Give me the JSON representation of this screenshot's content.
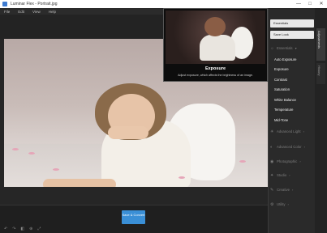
{
  "window": {
    "title": "Luminar Flex - Portrait.jpg",
    "controls": [
      "—",
      "□",
      "✕"
    ]
  },
  "menu": [
    "File",
    "Edit",
    "View",
    "Help"
  ],
  "preview": {
    "title": "Exposure",
    "description": "Adjust exposure, which affects the brightness of an image."
  },
  "panel": {
    "buttons": [
      "Essentials",
      "Save Look"
    ],
    "essentials": {
      "label": "Essentials",
      "items": [
        "Auto Exposure",
        "Exposure",
        "Contrast",
        "Saturation",
        "White Balance",
        "Temperature",
        "Mid-Tone"
      ]
    },
    "sections": [
      "Advanced Light",
      "Advanced Color",
      "Photographic",
      "Studio",
      "Creative",
      "Utility"
    ]
  },
  "side_tabs": [
    "Adjustments",
    "History"
  ],
  "bottom": {
    "save_label": "Save & Convert"
  }
}
